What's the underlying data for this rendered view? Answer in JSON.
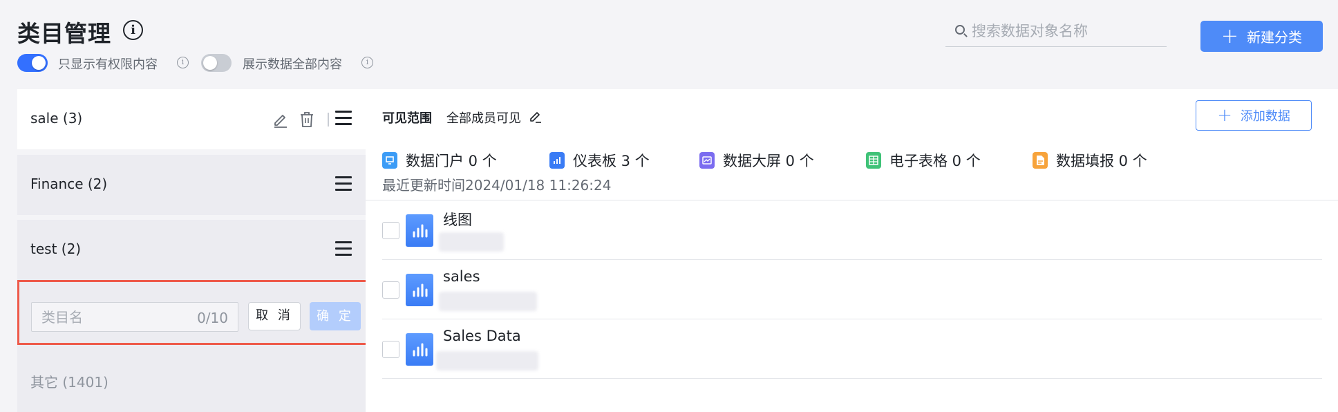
{
  "header": {
    "title": "类目管理",
    "title_info": "i",
    "toggle_permission_label": "只显示有权限内容",
    "toggle_all_label": "展示数据全部内容",
    "small_info": "i",
    "search_placeholder": "搜索数据对象名称",
    "new_category_label": "新建分类",
    "plus": "+"
  },
  "sidebar": {
    "categories": [
      {
        "label": "sale (3)"
      },
      {
        "label": "Finance (2)"
      },
      {
        "label": "test (2)"
      }
    ],
    "add_form": {
      "placeholder": "类目名",
      "counter": "0/10",
      "cancel_label": "取 消",
      "confirm_label": "确 定"
    },
    "other": {
      "label": "其它 (1401)"
    }
  },
  "main": {
    "visibility_label": "可见范围",
    "visibility_value": "全部成员可见",
    "add_data_label": "添加数据",
    "stats": [
      {
        "label": "数据门户 0 个",
        "icon": "portal-icon",
        "color": "#3c9cf6"
      },
      {
        "label": "仪表板 3 个",
        "icon": "dashboard-icon",
        "color": "#3a7cf5"
      },
      {
        "label": "数据大屏 0 个",
        "icon": "big-screen-icon",
        "color": "#7b6cf0"
      },
      {
        "label": "电子表格 0 个",
        "icon": "spreadsheet-icon",
        "color": "#3fc277"
      },
      {
        "label": "数据填报 0 个",
        "icon": "data-entry-icon",
        "color": "#f7a33b"
      }
    ],
    "updated": "最近更新时间2024/01/18 11:26:24",
    "rows": [
      {
        "title": "线图"
      },
      {
        "title": "sales"
      },
      {
        "title": "Sales Data"
      }
    ]
  },
  "colors": {
    "accent": "#4e8bf8",
    "toggle_on": "#3370ff",
    "highlight_border": "#ee5a4a"
  }
}
